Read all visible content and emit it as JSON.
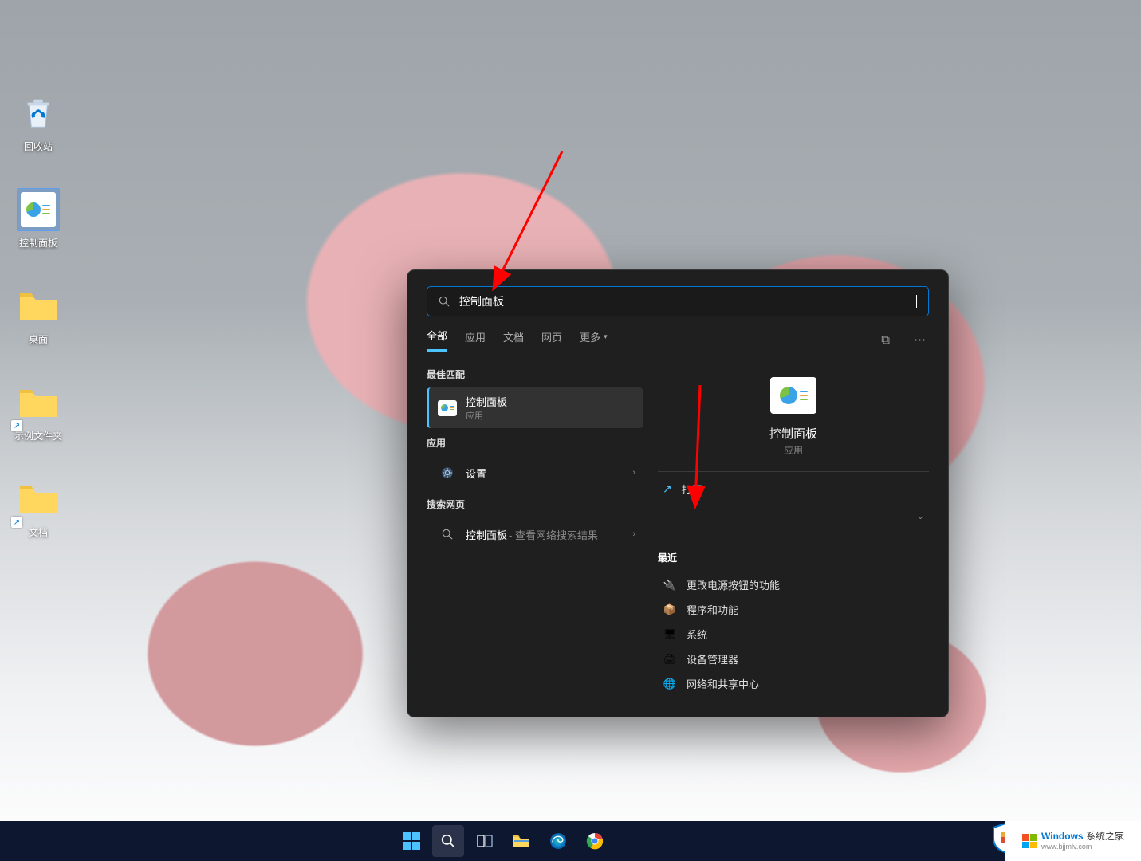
{
  "desktop": {
    "icons": [
      {
        "label": "回收站"
      },
      {
        "label": "控制面板"
      },
      {
        "label": "桌面"
      },
      {
        "label": "示例文件夹"
      },
      {
        "label": "文档"
      }
    ]
  },
  "search": {
    "query": "控制面板",
    "tabs": [
      "全部",
      "应用",
      "文档",
      "网页",
      "更多"
    ],
    "best_match_label": "最佳匹配",
    "apps_label": "应用",
    "search_web_label": "搜索网页",
    "best_match": {
      "title": "控制面板",
      "subtitle": "应用"
    },
    "apps": [
      {
        "title": "设置"
      }
    ],
    "web": {
      "title": "控制面板",
      "subtitle": "- 查看网络搜索结果"
    }
  },
  "preview": {
    "title": "控制面板",
    "subtitle": "应用",
    "open_label": "打开",
    "recent_label": "最近",
    "recent": [
      "更改电源按钮的功能",
      "程序和功能",
      "系统",
      "设备管理器",
      "网络和共享中心"
    ]
  },
  "watermark": {
    "brand": "Windows",
    "suffix": " 系统之家",
    "url": "www.bjjmlv.com"
  }
}
